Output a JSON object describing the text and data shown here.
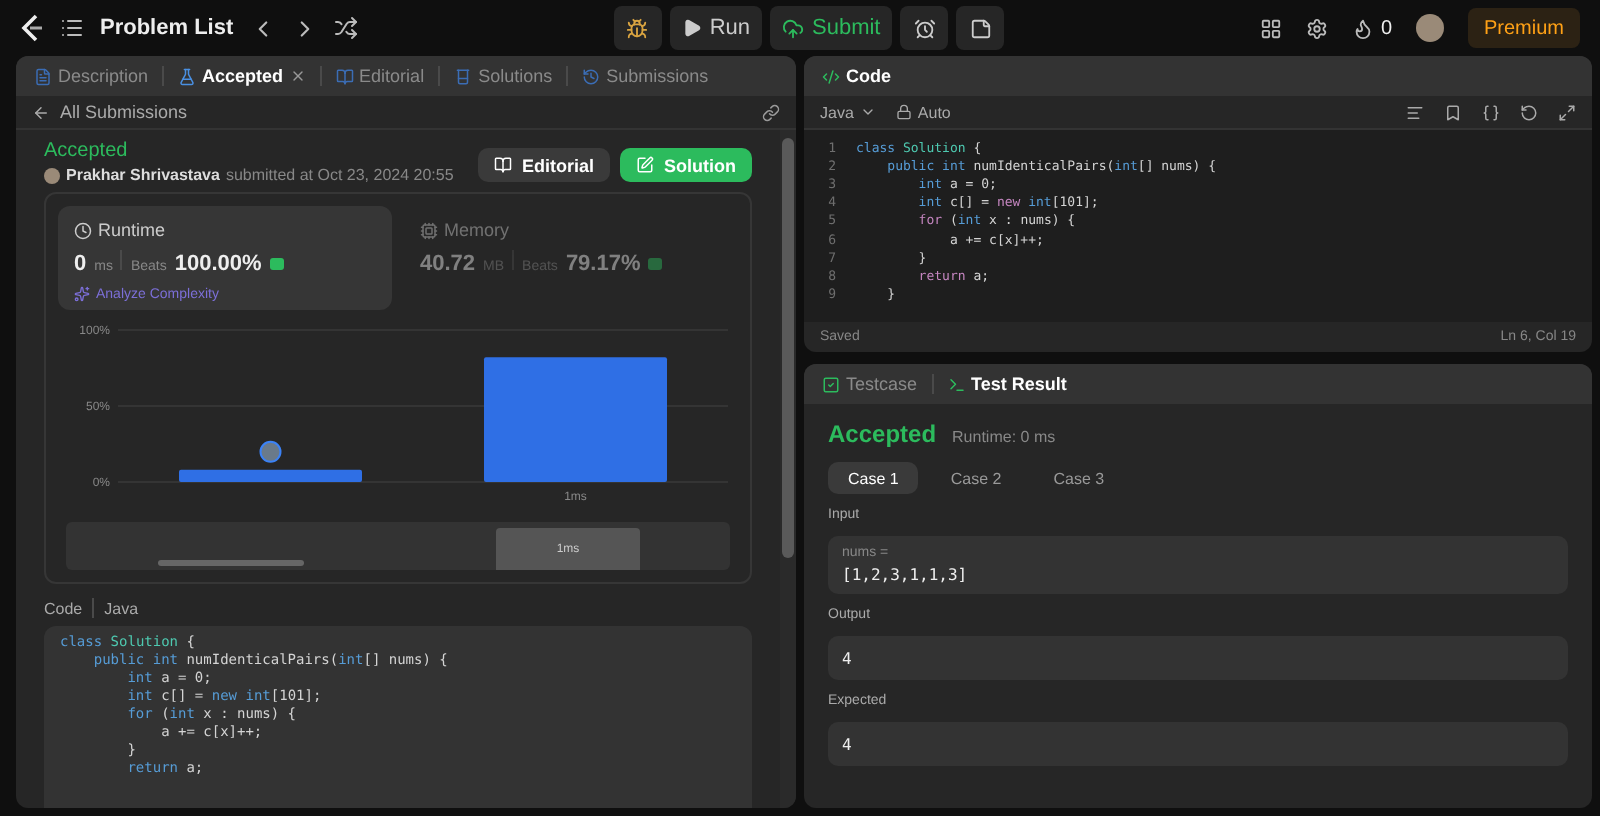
{
  "top_bar": {
    "title": "Problem List",
    "run": "Run",
    "submit": "Submit",
    "streak": "0",
    "premium": "Premium"
  },
  "left_panel": {
    "tabs": [
      {
        "label": "Description",
        "selected": false,
        "closable": false
      },
      {
        "label": "Accepted",
        "selected": true,
        "closable": true
      },
      {
        "label": "Editorial",
        "selected": false,
        "closable": false
      },
      {
        "label": "Solutions",
        "selected": false,
        "closable": false
      },
      {
        "label": "Submissions",
        "selected": false,
        "closable": false
      }
    ],
    "back": "All Submissions",
    "status": "Accepted",
    "author": "Prakhar Shrivastava",
    "submitted": "submitted at Oct 23, 2024 20:55",
    "buttons": [
      {
        "label": "Editorial",
        "kind": "plain"
      },
      {
        "label": "Solution",
        "kind": "primary"
      }
    ],
    "stats": [
      {
        "title": "Runtime",
        "value": "0",
        "unit": "ms",
        "beats_label": "Beats",
        "beats": "100.00%",
        "selected": true
      },
      {
        "title": "Memory",
        "value": "40.72",
        "unit": "MB",
        "beats_label": "Beats",
        "beats": "79.17%",
        "selected": false
      }
    ],
    "analyze": "Analyze Complexity",
    "chart_data": {
      "type": "bar",
      "categories": [
        null,
        "1ms"
      ],
      "values": [
        0.08,
        0.82
      ],
      "ylim": [
        0,
        1
      ],
      "yticks": [
        {
          "value": 0,
          "label": "0%"
        },
        {
          "value": 0.5,
          "label": "50%"
        },
        {
          "value": 1,
          "label": "100%"
        }
      ]
    },
    "navigator_label": "1ms",
    "code_label": "Code",
    "code_lang": "Java",
    "code": [
      [
        {
          "text": "class ",
          "kind": "kw"
        },
        {
          "text": "Solution",
          "kind": "ty"
        },
        {
          "text": " {",
          "kind": "p"
        }
      ],
      [
        {
          "text": "    public int ",
          "kind": "kw"
        },
        {
          "text": "numIdenticalPairs(",
          "kind": "p"
        },
        {
          "text": "int",
          "kind": "kw"
        },
        {
          "text": "[] nums) {",
          "kind": "p"
        }
      ],
      [
        {
          "text": "        int ",
          "kind": "kw"
        },
        {
          "text": "a = 0;",
          "kind": "p"
        }
      ],
      [
        {
          "text": "        int ",
          "kind": "kw"
        },
        {
          "text": "c[] = ",
          "kind": "p"
        },
        {
          "text": "new int",
          "kind": "kw"
        },
        {
          "text": "[101];",
          "kind": "p"
        }
      ],
      [
        {
          "text": "        for ",
          "kind": "kw"
        },
        {
          "text": "(",
          "kind": "p"
        },
        {
          "text": "int ",
          "kind": "kw"
        },
        {
          "text": "x : nums) {",
          "kind": "p"
        }
      ],
      [
        {
          "text": "            a += c[x]++;",
          "kind": "p"
        }
      ],
      [
        {
          "text": "        }",
          "kind": "p"
        }
      ],
      [
        {
          "text": "        return ",
          "kind": "kw"
        },
        {
          "text": "a;",
          "kind": "p"
        }
      ]
    ]
  },
  "code_panel": {
    "title": "Code",
    "language": "Java",
    "mode": "Auto",
    "lines": [
      {
        "n": "1",
        "tokens": [
          {
            "text": "class ",
            "kind": "kw"
          },
          {
            "text": "Solution",
            "kind": "ty"
          },
          {
            "text": " {",
            "kind": "p"
          }
        ]
      },
      {
        "n": "2",
        "tokens": [
          {
            "text": "    public int ",
            "kind": "kw"
          },
          {
            "text": "numIdenticalPairs(",
            "kind": "p"
          },
          {
            "text": "int",
            "kind": "kw"
          },
          {
            "text": "[] nums) {",
            "kind": "p"
          }
        ]
      },
      {
        "n": "3",
        "tokens": [
          {
            "text": "        int ",
            "kind": "kw"
          },
          {
            "text": "a = 0;",
            "kind": "p"
          }
        ]
      },
      {
        "n": "4",
        "tokens": [
          {
            "text": "        int ",
            "kind": "kw"
          },
          {
            "text": "c[] = ",
            "kind": "p"
          },
          {
            "text": "new ",
            "kind": "mg"
          },
          {
            "text": "int",
            "kind": "kw"
          },
          {
            "text": "[101];",
            "kind": "p"
          }
        ]
      },
      {
        "n": "5",
        "tokens": [
          {
            "text": "        for ",
            "kind": "mg"
          },
          {
            "text": "(",
            "kind": "p"
          },
          {
            "text": "int ",
            "kind": "kw"
          },
          {
            "text": "x : nums) {",
            "kind": "p"
          }
        ]
      },
      {
        "n": "6",
        "tokens": [
          {
            "text": "            a += c[x]++;",
            "kind": "p"
          }
        ]
      },
      {
        "n": "7",
        "tokens": [
          {
            "text": "        }",
            "kind": "p"
          }
        ]
      },
      {
        "n": "8",
        "tokens": [
          {
            "text": "        return ",
            "kind": "mg"
          },
          {
            "text": "a;",
            "kind": "p"
          }
        ]
      },
      {
        "n": "9",
        "tokens": [
          {
            "text": "    }",
            "kind": "p"
          }
        ]
      }
    ],
    "saved": "Saved",
    "position": "Ln 6, Col 19"
  },
  "test_panel": {
    "tabs": [
      {
        "label": "Testcase",
        "selected": false
      },
      {
        "label": "Test Result",
        "selected": true
      }
    ],
    "status": "Accepted",
    "runtime": "Runtime: 0 ms",
    "cases": [
      {
        "label": "Case 1",
        "selected": true
      },
      {
        "label": "Case 2",
        "selected": false
      },
      {
        "label": "Case 3",
        "selected": false
      }
    ],
    "input_label": "Input",
    "input_name": "nums =",
    "input_value": "[1,2,3,1,1,3]",
    "output_label": "Output",
    "output_value": "4",
    "expected_label": "Expected",
    "expected_value": "4"
  }
}
